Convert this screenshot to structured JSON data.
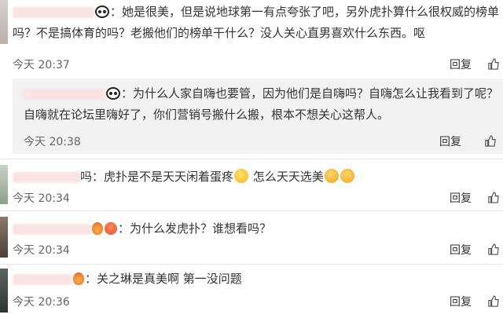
{
  "comments": [
    {
      "line1": "：她是很美，但是说地球第一有点夸张了吧，另外虎扑算什么很权威的榜单",
      "line2": "吗？不是搞体育的吗？老搬他们的榜单干什么？没人关心直男喜欢什么东西。呕",
      "time": "今天 20:37",
      "reply": "回复"
    },
    {
      "line1": "：为什么人家自嗨也要管，因为他们是自嗨吗？自嗨怎么让我看到了呢？",
      "line2": "自嗨就在论坛里嗨好了，你们营销号搬什么搬，根本不想关心这帮人。",
      "time": "今天 20:38",
      "reply": "回复"
    },
    {
      "name_tail": "吗",
      "line1a": "：虎扑是不是天天闲着蛋疼",
      "line1b": "怎么天天选美",
      "time": "今天 20:34",
      "reply": "回复"
    },
    {
      "line1": "：为什么发虎扑？谁想看吗？",
      "time": "今天 20:34",
      "reply": "回复"
    },
    {
      "line1": "：关之琳是真美啊 第一没问题",
      "time": "今天 20:36",
      "reply": "回复"
    }
  ],
  "icons": {
    "panda": "panda-emoji-icon",
    "sweat": "sweat-emoji-icon",
    "love": "heart-eyes-emoji-icon",
    "like": "thumbs-up-icon",
    "badge": "user-badge-icon"
  },
  "colors": {
    "reply_background": "#f2f2f2",
    "name_blur": "#fbe3e3",
    "divider": "#e6e6e6"
  }
}
